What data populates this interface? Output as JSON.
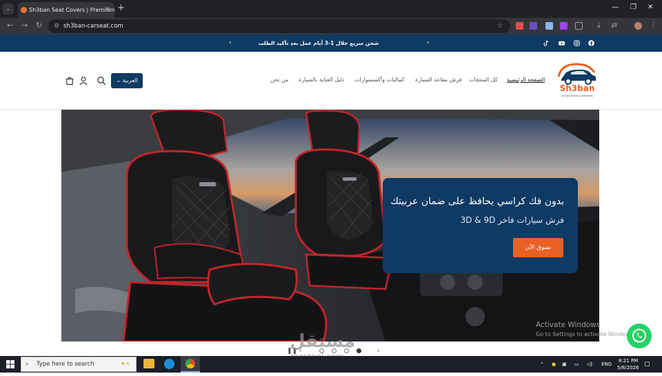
{
  "browser": {
    "tab_title": "Sh3ban Seat Covers | Premium",
    "url": "sh3ban-carseat.com"
  },
  "announcement": {
    "message": "شحن سريع خلال 1-3 أيام عمل بعد تأكيد الطلب"
  },
  "header": {
    "logo_text": "Sh3ban",
    "logo_tagline": "CAR SEAT COVERS & ACCESSORIES",
    "nav": [
      "الصفحة الرئيسية",
      "كل المنتجات",
      "فرش مقاعد السيارة",
      "كماليات وأكسسوارات",
      "دليل العناية بالسيارة",
      "من نحن"
    ],
    "language": "العربية"
  },
  "hero": {
    "headline": "بدون فك كراسي يحافظ على ضمان عربيتك",
    "subheadline": "فرش سيارات فاخر 3D & 9D",
    "cta": "تسوق الآن",
    "slides": 4,
    "active_slide": 4
  },
  "overlay": {
    "activate_title": "Activate Windows",
    "activate_sub": "Go to Settings to activate Windows.",
    "mostaql_ar": "مستقل",
    "mostaql_en": "mostaql.com"
  },
  "taskbar": {
    "search_placeholder": "Type here to search",
    "lang": "ENG",
    "time": "8:21 PM",
    "date": "5/8/2026"
  },
  "colors": {
    "brand_navy": "#0f3a63",
    "cta_orange": "#e96124",
    "whatsapp": "#25d366"
  }
}
